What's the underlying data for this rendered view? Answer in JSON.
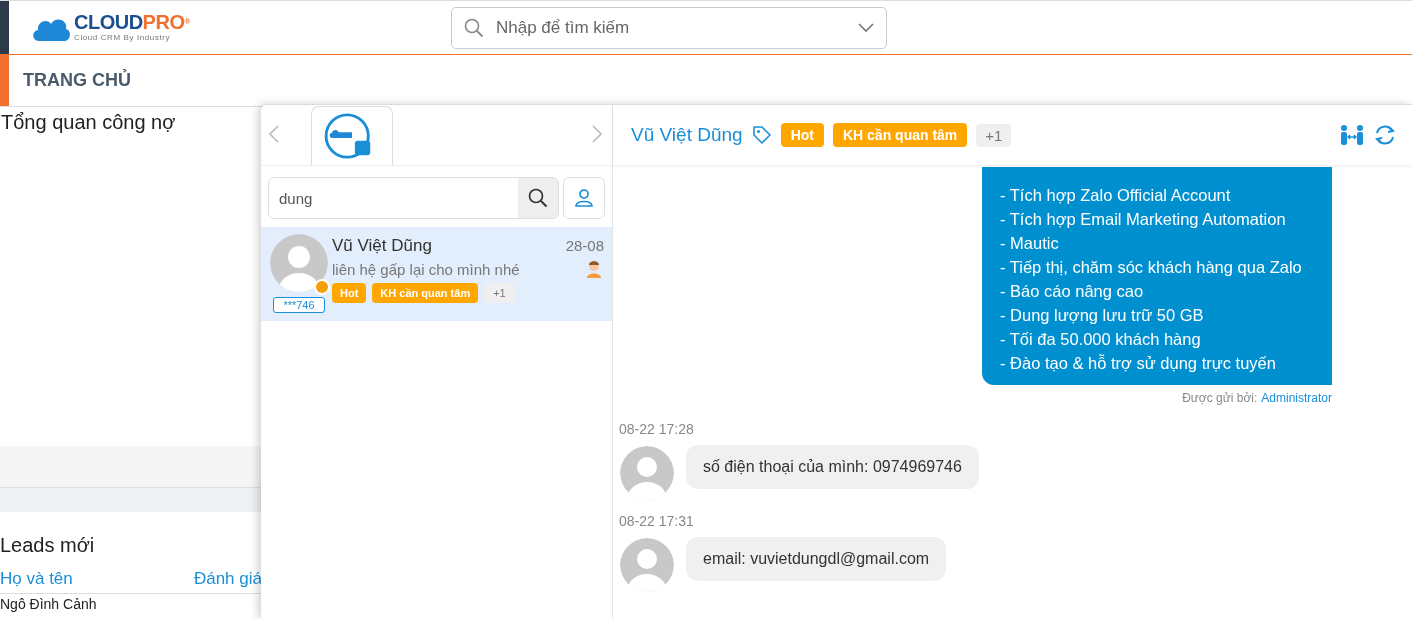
{
  "header": {
    "logo": {
      "primary": "CLOUD",
      "accent": "PRO",
      "mark": "®",
      "tagline": "Cloud CRM By Industry"
    },
    "search": {
      "placeholder": "Nhập để tìm kiếm"
    }
  },
  "nav": {
    "items": [
      {
        "label": "TRANG CHỦ",
        "selected": true
      }
    ]
  },
  "dashboard": {
    "debt_title": "Tổng quan công nợ",
    "leads": {
      "title": "Leads mới",
      "columns": [
        "Họ và tên",
        "Đánh giá"
      ],
      "rows": [
        [
          "Ngô Đình Cảnh"
        ]
      ]
    }
  },
  "chat": {
    "channel_tabs": [
      {
        "kind": "zalo",
        "selected": true
      }
    ],
    "search": {
      "value": "dung"
    },
    "conversations": [
      {
        "name": "Vũ Việt Dũng",
        "date": "28-08",
        "preview": "liên hệ gấp lại cho mình nhé",
        "phone": "***746",
        "online": true,
        "selected": true,
        "tags": [
          "Hot",
          "KH cần quan tâm"
        ],
        "more": "+1"
      }
    ],
    "header": {
      "name": "Vũ Việt Dũng",
      "tags": [
        "Hot",
        "KH cần quan tâm"
      ],
      "more": "+1"
    },
    "messages": [
      {
        "kind": "outgoing",
        "lines": [
          "- Tích hợp Zalo Official Account",
          "- Tích hợp Email Marketing Automation",
          "- Mautic",
          "- Tiếp thị, chăm sóc khách hàng qua Zalo",
          "- Báo cáo nâng cao",
          "- Dung lượng lưu trữ 50 GB",
          "- Tối đa 50.000 khách hàng",
          "- Đào tạo & hỗ trợ sử dụng trực tuyến"
        ],
        "sender_label": "Được gửi bởi:",
        "sender": "Administrator"
      },
      {
        "kind": "incoming",
        "time": "08-22 17:28",
        "text": "số điện thoại của mình: 0974969746"
      },
      {
        "kind": "incoming",
        "time": "08-22 17:31",
        "text": "email: vuvietdungdl@gmail.com"
      }
    ]
  }
}
